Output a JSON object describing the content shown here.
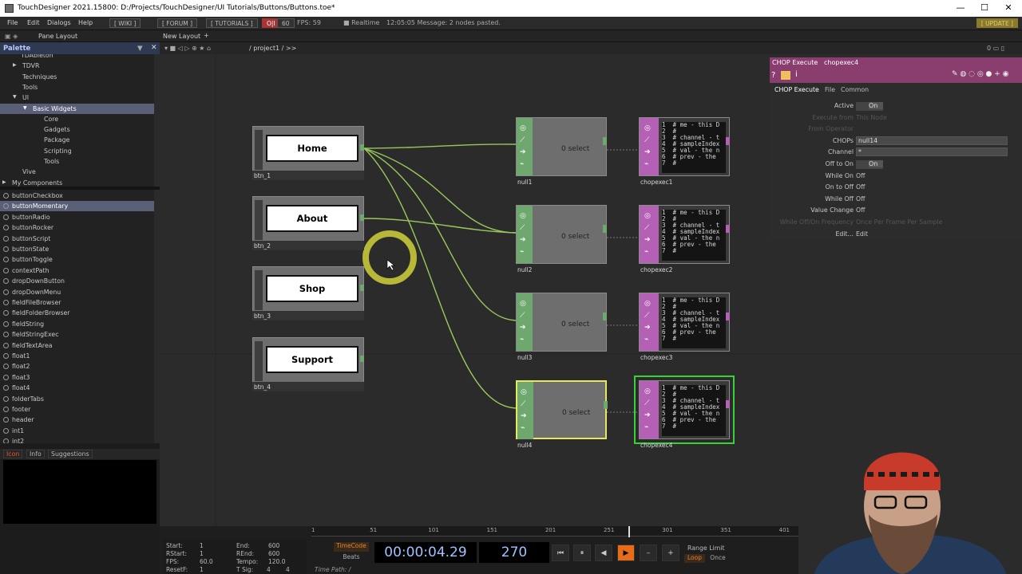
{
  "window": {
    "title": "TouchDesigner 2021.15800: D:/Projects/TouchDesigner/UI Tutorials/Buttons/Buttons.toe*",
    "min": "—",
    "max": "☐",
    "close": "✕"
  },
  "menubar": {
    "file": "File",
    "edit": "Edit",
    "dialogs": "Dialogs",
    "help": "Help",
    "wiki": "[ WIKI ]",
    "forum": "[ FORUM ]",
    "tutorials": "[ TUTORIALS ]",
    "oi": "O|I",
    "fps_cap": "60",
    "fps": "FPS: 59",
    "realtime": "Realtime",
    "message": "12:05:05 Message: 2 nodes pasted.",
    "update": "[ UPDATE ]"
  },
  "panebar": {
    "pane_layout": "Pane Layout",
    "new_layout": "New Layout",
    "plus": "+"
  },
  "palette": {
    "title": "Palette",
    "tree": [
      {
        "label": "TDAbleton",
        "indent": 26
      },
      {
        "label": "TDVR",
        "indent": 28,
        "arrow": "▶"
      },
      {
        "label": "Techniques",
        "indent": 28
      },
      {
        "label": "Tools",
        "indent": 28
      },
      {
        "label": "UI",
        "indent": 28,
        "arrow": "▼"
      },
      {
        "label": "Basic Widgets",
        "indent": 41,
        "arrow": "▼",
        "sel": true
      },
      {
        "label": "Core",
        "indent": 55
      },
      {
        "label": "Gadgets",
        "indent": 55
      },
      {
        "label": "Package",
        "indent": 55
      },
      {
        "label": "Scripting",
        "indent": 55
      },
      {
        "label": "Tools",
        "indent": 55
      },
      {
        "label": "Vive",
        "indent": 28
      },
      {
        "label": "My Components",
        "indent": 15,
        "arrow": "▶"
      }
    ],
    "components": [
      "buttonCheckbox",
      "buttonMomentary",
      "buttonRadio",
      "buttonRocker",
      "buttonScript",
      "buttonState",
      "buttonToggle",
      "contextPath",
      "dropDownButton",
      "dropDownMenu",
      "fieldFileBrowser",
      "fieldFolderBrowser",
      "fieldString",
      "fieldStringExec",
      "fieldTextArea",
      "float1",
      "float2",
      "float3",
      "float4",
      "folderTabs",
      "footer",
      "header",
      "int1",
      "int2"
    ],
    "selected_component": "buttonMomentary",
    "tabs": [
      "Icon",
      "Info",
      "Suggestions"
    ]
  },
  "network": {
    "path": "/ project1 / >>",
    "buttons": [
      {
        "label": "Home",
        "name": "btn_1"
      },
      {
        "label": "About",
        "name": "btn_2"
      },
      {
        "label": "Shop",
        "name": "btn_3"
      },
      {
        "label": "Support",
        "name": "btn_4"
      }
    ],
    "nulls": [
      {
        "name": "null1",
        "info": "0 select"
      },
      {
        "name": "null2",
        "info": "0 select"
      },
      {
        "name": "null3",
        "info": "0 select"
      },
      {
        "name": "null4",
        "info": "0 select"
      }
    ],
    "execs": [
      {
        "name": "chopexec1"
      },
      {
        "name": "chopexec2"
      },
      {
        "name": "chopexec3"
      },
      {
        "name": "chopexec4"
      }
    ],
    "dat_code": "1  # me - this D\n2  #\n3  # channel - t\n4  # sampleIndex\n5  # val - the n\n6  # prev - the\n7  #"
  },
  "params": {
    "type": "CHOP Execute",
    "name": "chopexec4",
    "tabs": [
      "CHOP Execute",
      "File",
      "Common"
    ],
    "rows": [
      {
        "label": "Active",
        "value": "On",
        "kind": "toggle"
      },
      {
        "label": "Execute from",
        "value": "This Node",
        "kind": "dim"
      },
      {
        "label": "From Operator",
        "value": "",
        "kind": "dim"
      },
      {
        "label": "CHOPs",
        "value": "null14",
        "kind": "field"
      },
      {
        "label": "Channel",
        "value": "*",
        "kind": "field"
      },
      {
        "label": "Off to On",
        "value": "On",
        "kind": "toggle"
      },
      {
        "label": "While On",
        "value": "Off",
        "kind": "text"
      },
      {
        "label": "On to Off",
        "value": "Off",
        "kind": "text"
      },
      {
        "label": "While Off",
        "value": "Off",
        "kind": "text"
      },
      {
        "label": "Value Change",
        "value": "Off",
        "kind": "text"
      },
      {
        "label": "While Off/On Frequency",
        "value": "Once Per Frame Per Sample",
        "kind": "dim"
      },
      {
        "label": "Edit...",
        "value": "Edit",
        "kind": "text"
      }
    ]
  },
  "timeline": {
    "start_label": "Start:",
    "start": "1",
    "end_label": "End:",
    "end": "600",
    "rstart_label": "RStart:",
    "rstart": "1",
    "rend_label": "REnd:",
    "rend": "600",
    "fps_label": "FPS:",
    "fps": "60.0",
    "tempo_label": "Tempo:",
    "tempo": "120.0",
    "resetf_label": "ResetF:",
    "resetf": "1",
    "tsig_label": "T Sig:",
    "tsig_a": "4",
    "tsig_b": "4",
    "timecode_btn": "TimeCode",
    "beats_btn": "Beats",
    "timecode": "00:00:04.29",
    "frame": "270",
    "range_limit": "Range Limit",
    "loop": "Loop",
    "once": "Once",
    "time_path": "Time Path: /",
    "ticks": [
      "1",
      "51",
      "101",
      "151",
      "201",
      "251",
      "301",
      "351",
      "401",
      "451",
      "501",
      "551",
      "600"
    ]
  }
}
